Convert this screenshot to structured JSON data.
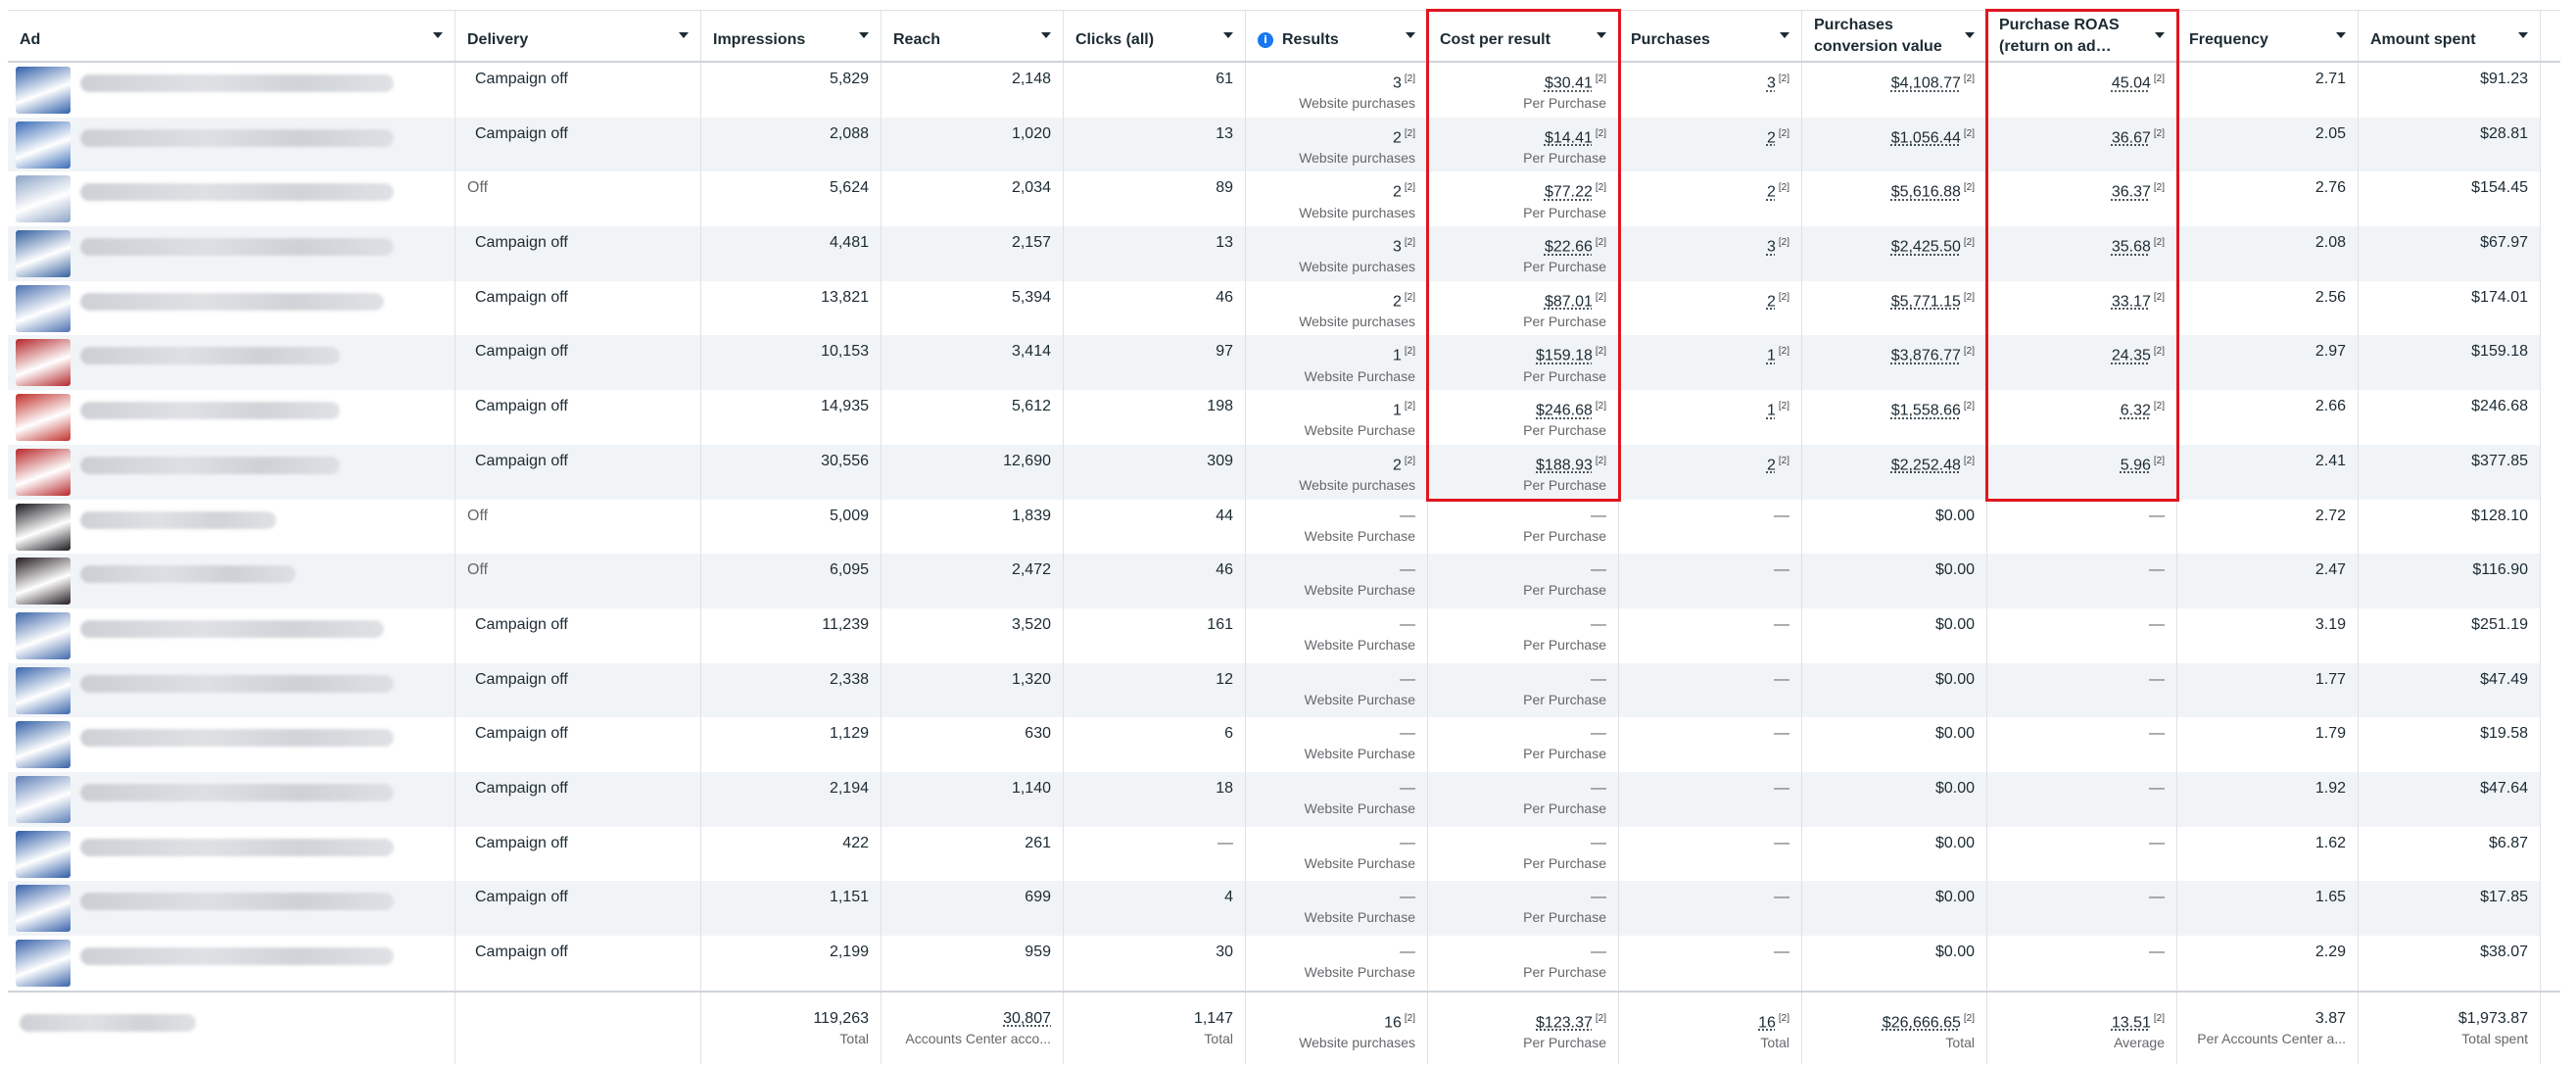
{
  "columns": [
    {
      "label": "Ad"
    },
    {
      "label": "Delivery"
    },
    {
      "label": "Impressions"
    },
    {
      "label": "Reach"
    },
    {
      "label": "Clicks (all)"
    },
    {
      "label": "Results",
      "info_icon": "i"
    },
    {
      "label": "Cost per result"
    },
    {
      "label": "Purchases"
    },
    {
      "label": "Purchases conversion value"
    },
    {
      "label": "Purchase ROAS (return on ad…"
    },
    {
      "label": "Frequency"
    },
    {
      "label": "Amount spent"
    }
  ],
  "footnote_marker": "[2]",
  "dash": "—",
  "rows": [
    {
      "thumb": "#2f5fa8",
      "delivery": "Campaign off",
      "dot": true,
      "impressions": "5,829",
      "reach": "2,148",
      "clicks": "61",
      "results": "3",
      "results_label": "Website purchases",
      "cpr": "$30.41",
      "cpr_label": "Per Purchase",
      "purchases": "3",
      "conv_value": "$4,108.77",
      "roas": "45.04",
      "frequency": "2.71",
      "spent": "$91.23"
    },
    {
      "thumb": "#3a6cb8",
      "delivery": "Campaign off",
      "dot": true,
      "impressions": "2,088",
      "reach": "1,020",
      "clicks": "13",
      "results": "2",
      "results_label": "Website purchases",
      "cpr": "$14.41",
      "cpr_label": "Per Purchase",
      "purchases": "2",
      "conv_value": "$1,056.44",
      "roas": "36.67",
      "frequency": "2.05",
      "spent": "$28.81"
    },
    {
      "thumb": "#8da4c4",
      "delivery": "Off",
      "dot": false,
      "impressions": "5,624",
      "reach": "2,034",
      "clicks": "89",
      "results": "2",
      "results_label": "Website purchases",
      "cpr": "$77.22",
      "cpr_label": "Per Purchase",
      "purchases": "2",
      "conv_value": "$5,616.88",
      "roas": "36.37",
      "frequency": "2.76",
      "spent": "$154.45"
    },
    {
      "thumb": "#34609f",
      "delivery": "Campaign off",
      "dot": true,
      "impressions": "4,481",
      "reach": "2,157",
      "clicks": "13",
      "results": "3",
      "results_label": "Website purchases",
      "cpr": "$22.66",
      "cpr_label": "Per Purchase",
      "purchases": "3",
      "conv_value": "$2,425.50",
      "roas": "35.68",
      "frequency": "2.08",
      "spent": "$67.97"
    },
    {
      "thumb": "#4c70b0",
      "delivery": "Campaign off",
      "dot": true,
      "impressions": "13,821",
      "reach": "5,394",
      "clicks": "46",
      "results": "2",
      "results_label": "Website purchases",
      "cpr": "$87.01",
      "cpr_label": "Per Purchase",
      "purchases": "2",
      "conv_value": "$5,771.15",
      "roas": "33.17",
      "frequency": "2.56",
      "spent": "$174.01"
    },
    {
      "thumb": "#b3262a",
      "delivery": "Campaign off",
      "dot": true,
      "impressions": "10,153",
      "reach": "3,414",
      "clicks": "97",
      "results": "1",
      "results_label": "Website Purchase",
      "cpr": "$159.18",
      "cpr_label": "Per Purchase",
      "purchases": "1",
      "conv_value": "$3,876.77",
      "roas": "24.35",
      "frequency": "2.97",
      "spent": "$159.18"
    },
    {
      "thumb": "#c0302c",
      "delivery": "Campaign off",
      "dot": true,
      "impressions": "14,935",
      "reach": "5,612",
      "clicks": "198",
      "results": "1",
      "results_label": "Website Purchase",
      "cpr": "$246.68",
      "cpr_label": "Per Purchase",
      "purchases": "1",
      "conv_value": "$1,558.66",
      "roas": "6.32",
      "frequency": "2.66",
      "spent": "$246.68"
    },
    {
      "thumb": "#b8282b",
      "delivery": "Campaign off",
      "dot": true,
      "impressions": "30,556",
      "reach": "12,690",
      "clicks": "309",
      "results": "2",
      "results_label": "Website purchases",
      "cpr": "$188.93",
      "cpr_label": "Per Purchase",
      "purchases": "2",
      "conv_value": "$2,252.48",
      "roas": "5.96",
      "frequency": "2.41",
      "spent": "$377.85"
    },
    {
      "thumb": "#1a1a1f",
      "delivery": "Off",
      "dot": false,
      "impressions": "5,009",
      "reach": "1,839",
      "clicks": "44",
      "results": null,
      "results_label": "Website Purchase",
      "cpr": null,
      "cpr_label": "Per Purchase",
      "purchases": null,
      "conv_value": "$0.00",
      "roas": null,
      "frequency": "2.72",
      "spent": "$128.10"
    },
    {
      "thumb": "#231b1f",
      "delivery": "Off",
      "dot": false,
      "impressions": "6,095",
      "reach": "2,472",
      "clicks": "46",
      "results": null,
      "results_label": "Website Purchase",
      "cpr": null,
      "cpr_label": "Per Purchase",
      "purchases": null,
      "conv_value": "$0.00",
      "roas": null,
      "frequency": "2.47",
      "spent": "$116.90"
    },
    {
      "thumb": "#4168aa",
      "delivery": "Campaign off",
      "dot": true,
      "impressions": "11,239",
      "reach": "3,520",
      "clicks": "161",
      "results": null,
      "results_label": "Website Purchase",
      "cpr": null,
      "cpr_label": "Per Purchase",
      "purchases": null,
      "conv_value": "$0.00",
      "roas": null,
      "frequency": "3.19",
      "spent": "$251.19"
    },
    {
      "thumb": "#3b66ad",
      "delivery": "Campaign off",
      "dot": true,
      "impressions": "2,338",
      "reach": "1,320",
      "clicks": "12",
      "results": null,
      "results_label": "Website Purchase",
      "cpr": null,
      "cpr_label": "Per Purchase",
      "purchases": null,
      "conv_value": "$0.00",
      "roas": null,
      "frequency": "1.77",
      "spent": "$47.49"
    },
    {
      "thumb": "#3561a6",
      "delivery": "Campaign off",
      "dot": true,
      "impressions": "1,129",
      "reach": "630",
      "clicks": "6",
      "results": null,
      "results_label": "Website Purchase",
      "cpr": null,
      "cpr_label": "Per Purchase",
      "purchases": null,
      "conv_value": "$0.00",
      "roas": null,
      "frequency": "1.79",
      "spent": "$19.58"
    },
    {
      "thumb": "#5d7fb8",
      "delivery": "Campaign off",
      "dot": true,
      "impressions": "2,194",
      "reach": "1,140",
      "clicks": "18",
      "results": null,
      "results_label": "Website Purchase",
      "cpr": null,
      "cpr_label": "Per Purchase",
      "purchases": null,
      "conv_value": "$0.00",
      "roas": null,
      "frequency": "1.92",
      "spent": "$47.64"
    },
    {
      "thumb": "#2e5ca6",
      "delivery": "Campaign off",
      "dot": true,
      "impressions": "422",
      "reach": "261",
      "clicks": null,
      "results": null,
      "results_label": "Website Purchase",
      "cpr": null,
      "cpr_label": "Per Purchase",
      "purchases": null,
      "conv_value": "$0.00",
      "roas": null,
      "frequency": "1.62",
      "spent": "$6.87"
    },
    {
      "thumb": "#3862aa",
      "delivery": "Campaign off",
      "dot": true,
      "impressions": "1,151",
      "reach": "699",
      "clicks": "4",
      "results": null,
      "results_label": "Website Purchase",
      "cpr": null,
      "cpr_label": "Per Purchase",
      "purchases": null,
      "conv_value": "$0.00",
      "roas": null,
      "frequency": "1.65",
      "spent": "$17.85"
    },
    {
      "thumb": "#3a64ab",
      "delivery": "Campaign off",
      "dot": true,
      "impressions": "2,199",
      "reach": "959",
      "clicks": "30",
      "results": null,
      "results_label": "Website Purchase",
      "cpr": null,
      "cpr_label": "Per Purchase",
      "purchases": null,
      "conv_value": "$0.00",
      "roas": null,
      "frequency": "2.29",
      "spent": "$38.07"
    }
  ],
  "totals": {
    "impressions": "119,263",
    "impressions_label": "Total",
    "reach": "30,807",
    "reach_label": "Accounts Center acco...",
    "clicks": "1,147",
    "clicks_label": "Total",
    "results": "16",
    "results_label": "Website purchases",
    "cpr": "$123.37",
    "cpr_label": "Per Purchase",
    "purchases": "16",
    "purchases_label": "Total",
    "conv_value": "$26,666.65",
    "conv_value_label": "Total",
    "roas": "13.51",
    "roas_label": "Average",
    "frequency": "3.87",
    "frequency_label": "Per Accounts Center a...",
    "spent": "$1,973.87",
    "spent_label": "Total spent"
  },
  "highlight_color": "#e0161f",
  "highlighted_columns": [
    "Cost per result",
    "Purchase ROAS (return on ad…"
  ]
}
